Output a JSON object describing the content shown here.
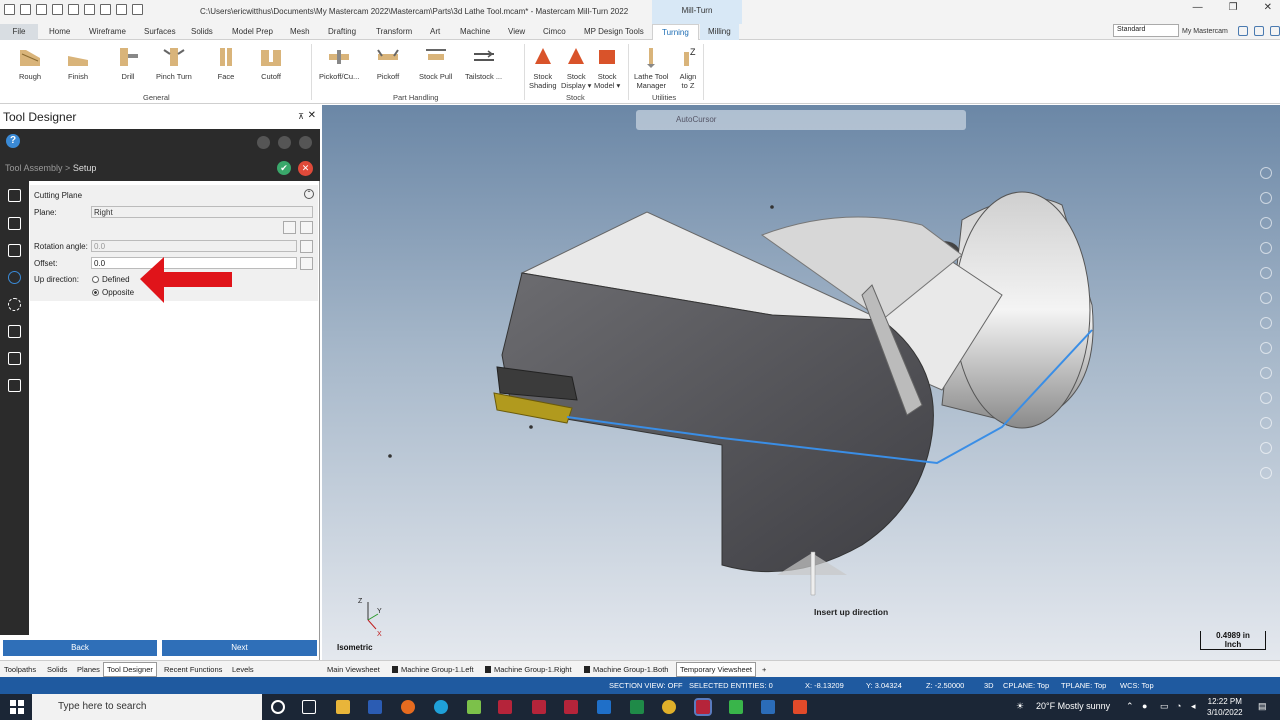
{
  "window": {
    "title": "C:\\Users\\ericwitthus\\Documents\\My Mastercam 2022\\Mastercam\\Parts\\3d Lathe Tool.mcam* - Mastercam Mill-Turn 2022",
    "context_tab": "Mill-Turn"
  },
  "ribbon_tabs": [
    "File",
    "Home",
    "Wireframe",
    "Surfaces",
    "Solids",
    "Model Prep",
    "Mesh",
    "Drafting",
    "Transform",
    "Art",
    "Machine",
    "View",
    "Cimco",
    "MP Design Tools",
    "Turning",
    "Milling"
  ],
  "active_tab": "Turning",
  "workspace_select": "Standard",
  "my_mastercam": "My Mastercam",
  "ribbon": {
    "general": [
      "Rough",
      "Finish",
      "Drill",
      "Pinch Turn",
      "Face",
      "Cutoff"
    ],
    "general_label": "General",
    "part_handling": [
      "Pickoff/Cu...",
      "Pickoff",
      "Stock Pull",
      "Tailstock ..."
    ],
    "part_handling_label": "Part Handling",
    "stock": [
      [
        "Stock",
        "Shading"
      ],
      [
        "Stock",
        "Display ▾"
      ],
      [
        "Stock",
        "Model ▾"
      ]
    ],
    "stock_label": "Stock",
    "utilities": [
      [
        "Lathe Tool",
        "Manager"
      ],
      [
        "Align",
        "to Z"
      ]
    ],
    "utilities_label": "Utilities"
  },
  "panel": {
    "title": "Tool Designer",
    "crumb_parent": "Tool Assembly",
    "crumb_sep": ">",
    "crumb_current": "Setup",
    "section": "Cutting Plane",
    "plane_label": "Plane:",
    "plane_value": "Right",
    "rotation_label": "Rotation angle:",
    "rotation_value": "0.0",
    "offset_label": "Offset:",
    "offset_value": "0.0",
    "up_label": "Up direction:",
    "up_options": [
      "Defined",
      "Opposite"
    ],
    "up_selected": "Opposite",
    "back": "Back",
    "next": "Next"
  },
  "viewport": {
    "autocursor": "AutoCursor",
    "prompt": "Insert up direction",
    "view_name": "Isometric",
    "scale_value": "0.4989 in",
    "scale_unit": "Inch",
    "axes": [
      "Z",
      "Y",
      "X"
    ]
  },
  "bottom_tabs": [
    "Toolpaths",
    "Solids",
    "Planes",
    "Tool Designer",
    "Recent Functions",
    "Levels"
  ],
  "active_bottom_tab": "Tool Designer",
  "viewsheets": [
    "Main Viewsheet",
    "Machine Group-1.Left",
    "Machine Group-1.Right",
    "Machine Group-1.Both",
    "Temporary Viewsheet",
    "+"
  ],
  "status": {
    "section_view": "SECTION VIEW: OFF",
    "selected": "SELECTED ENTITIES: 0",
    "x": "X:  -8.13209",
    "y": "Y:  3.04324",
    "z": "Z:  -2.50000",
    "mode": "3D",
    "cplane": "CPLANE: Top",
    "tplane": "TPLANE: Top",
    "wcs": "WCS: Top"
  },
  "taskbar": {
    "search_placeholder": "Type here to search",
    "weather": "20°F  Mostly sunny",
    "time": "12:22 PM",
    "date": "3/10/2022"
  },
  "colors": {
    "accent": "#2f6fb8",
    "panel_dark": "#2b2b2b",
    "annotation": "#e0141a",
    "edge_blue": "#3a8ee6"
  }
}
